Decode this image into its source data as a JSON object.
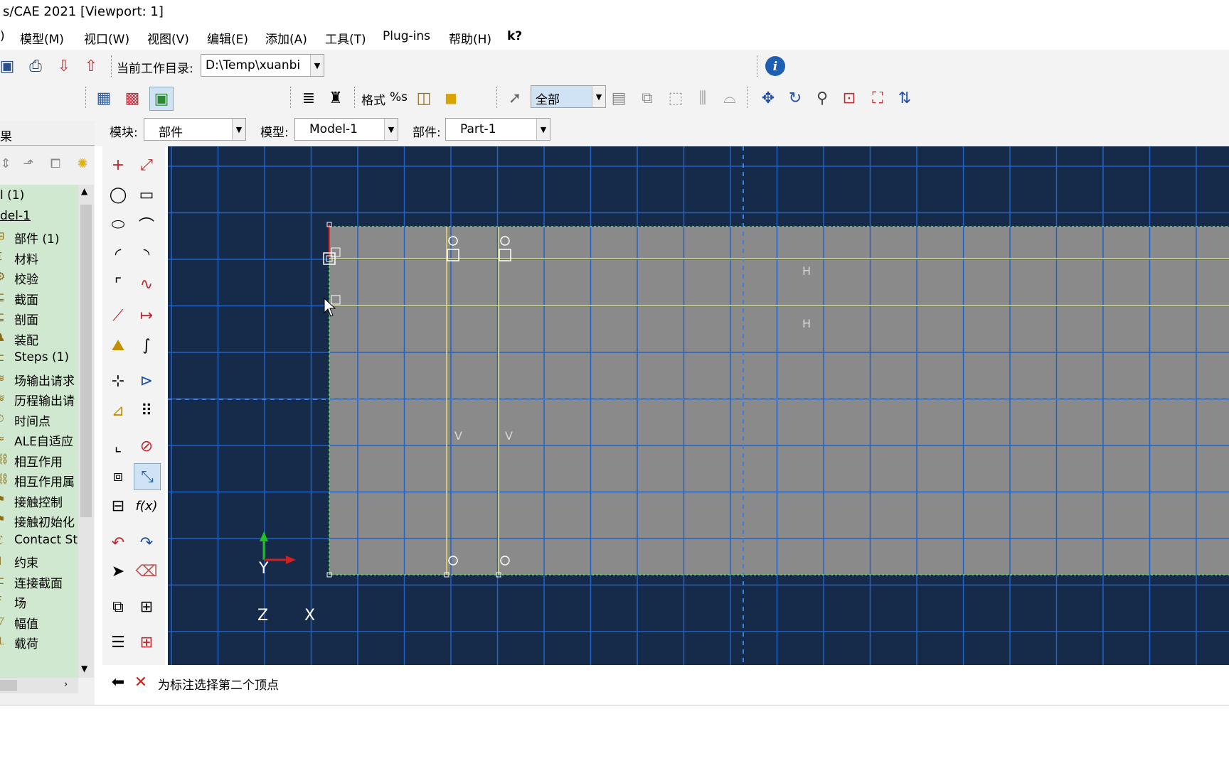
{
  "window": {
    "title": "s/CAE 2021 [Viewport: 1]"
  },
  "menu": [
    ")",
    "模型(M)",
    "视口(W)",
    "视图(V)",
    "编辑(E)",
    "添加(A)",
    "工具(T)",
    "Plug-ins",
    "帮助(H)",
    "k?"
  ],
  "toolbar": {
    "workdir_label": "当前工作目录:",
    "workdir_value": "D:\\Temp\\xuanbi",
    "format_label": "格式",
    "format_value": "%s",
    "selection_value": "全部"
  },
  "context": {
    "module_label": "模块:",
    "module_value": "部件",
    "model_label": "模型:",
    "model_value": "Model-1",
    "part_label": "部件:",
    "part_value": "Part-1"
  },
  "left_panel": {
    "tab_label": "果",
    "tree": [
      {
        "label": "l (1)"
      },
      {
        "label": "del-1"
      },
      {
        "label": "部件 (1)"
      },
      {
        "label": "材料"
      },
      {
        "label": "校验"
      },
      {
        "label": "截面"
      },
      {
        "label": "剖面"
      },
      {
        "label": "装配"
      },
      {
        "label": "Steps (1)"
      },
      {
        "label": "场输出请求"
      },
      {
        "label": "历程输出请"
      },
      {
        "label": "时间点"
      },
      {
        "label": "ALE自适应"
      },
      {
        "label": "相互作用"
      },
      {
        "label": "相互作用属"
      },
      {
        "label": "接触控制"
      },
      {
        "label": "接触初始化"
      },
      {
        "label": "Contact St"
      },
      {
        "label": "约束"
      },
      {
        "label": "连接截面"
      },
      {
        "label": "场"
      },
      {
        "label": "幅值"
      },
      {
        "label": "载荷"
      }
    ]
  },
  "canvas": {
    "label_h1": "H",
    "label_h2": "H",
    "label_v1": "V",
    "label_v2": "V",
    "axis_y": "Y",
    "axis_z": "Z",
    "axis_x": "X"
  },
  "status": {
    "prompt": "为标注选择第二个顶点"
  },
  "colors": {
    "canvas_bg": "#162a4a",
    "grid": "#1f63c8",
    "part_fill": "#8a8a8a",
    "constraint_line": "#e6e06a",
    "tree_bg": "#cfe8cf"
  }
}
